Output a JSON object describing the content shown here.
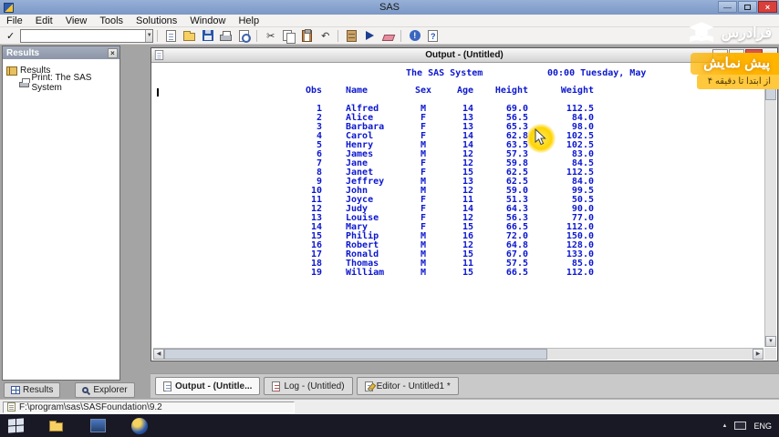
{
  "titlebar": {
    "title": "SAS"
  },
  "menu": {
    "items": [
      "File",
      "Edit",
      "View",
      "Tools",
      "Solutions",
      "Window",
      "Help"
    ]
  },
  "toolbar": {
    "command_value": ""
  },
  "icons": {
    "check": "✓",
    "dropdown": "▼",
    "cut": "✂",
    "undo": "↶",
    "minimize": "—",
    "close": "×",
    "up": "▲",
    "down": "▼",
    "left": "◀",
    "right": "▶"
  },
  "results_panel": {
    "title": "Results",
    "items": [
      {
        "label": "Results"
      },
      {
        "label": "Print: The SAS System"
      }
    ]
  },
  "output": {
    "title": "Output - (Untitled)",
    "page_title": "The SAS System",
    "page_date": "00:00 Tuesday, May",
    "columns": [
      "Obs",
      "Name",
      "Sex",
      "Age",
      "Height",
      "Weight"
    ],
    "rows": [
      [
        "1",
        "Alfred",
        "M",
        "14",
        "69.0",
        "112.5"
      ],
      [
        "2",
        "Alice",
        "F",
        "13",
        "56.5",
        "84.0"
      ],
      [
        "3",
        "Barbara",
        "F",
        "13",
        "65.3",
        "98.0"
      ],
      [
        "4",
        "Carol",
        "F",
        "14",
        "62.8",
        "102.5"
      ],
      [
        "5",
        "Henry",
        "M",
        "14",
        "63.5",
        "102.5"
      ],
      [
        "6",
        "James",
        "M",
        "12",
        "57.3",
        "83.0"
      ],
      [
        "7",
        "Jane",
        "F",
        "12",
        "59.8",
        "84.5"
      ],
      [
        "8",
        "Janet",
        "F",
        "15",
        "62.5",
        "112.5"
      ],
      [
        "9",
        "Jeffrey",
        "M",
        "13",
        "62.5",
        "84.0"
      ],
      [
        "10",
        "John",
        "M",
        "12",
        "59.0",
        "99.5"
      ],
      [
        "11",
        "Joyce",
        "F",
        "11",
        "51.3",
        "50.5"
      ],
      [
        "12",
        "Judy",
        "F",
        "14",
        "64.3",
        "90.0"
      ],
      [
        "13",
        "Louise",
        "F",
        "12",
        "56.3",
        "77.0"
      ],
      [
        "14",
        "Mary",
        "F",
        "15",
        "66.5",
        "112.0"
      ],
      [
        "15",
        "Philip",
        "M",
        "16",
        "72.0",
        "150.0"
      ],
      [
        "16",
        "Robert",
        "M",
        "12",
        "64.8",
        "128.0"
      ],
      [
        "17",
        "Ronald",
        "M",
        "15",
        "67.0",
        "133.0"
      ],
      [
        "18",
        "Thomas",
        "M",
        "11",
        "57.5",
        "85.0"
      ],
      [
        "19",
        "William",
        "M",
        "15",
        "66.5",
        "112.0"
      ]
    ]
  },
  "window_tabs": [
    {
      "label": "Output - (Untitle..."
    },
    {
      "label": "Log - (Untitled)"
    },
    {
      "label": "Editor - Untitled1 *"
    }
  ],
  "panel_tabs": [
    {
      "label": "Results"
    },
    {
      "label": "Explorer"
    }
  ],
  "statusbar": {
    "path": "F:\\program\\sas\\SASFoundation\\9.2"
  },
  "taskbar": {
    "language": "ENG"
  },
  "watermark": {
    "brand": "فرادرس",
    "line1": "پیش نمایش",
    "line2": "از ابتدا تا دقیقه ۴"
  },
  "colors": {
    "output_text": "#0c17cf",
    "watermark_yellow": "#ffb400",
    "titlebar_blue": "#7b97c4"
  }
}
